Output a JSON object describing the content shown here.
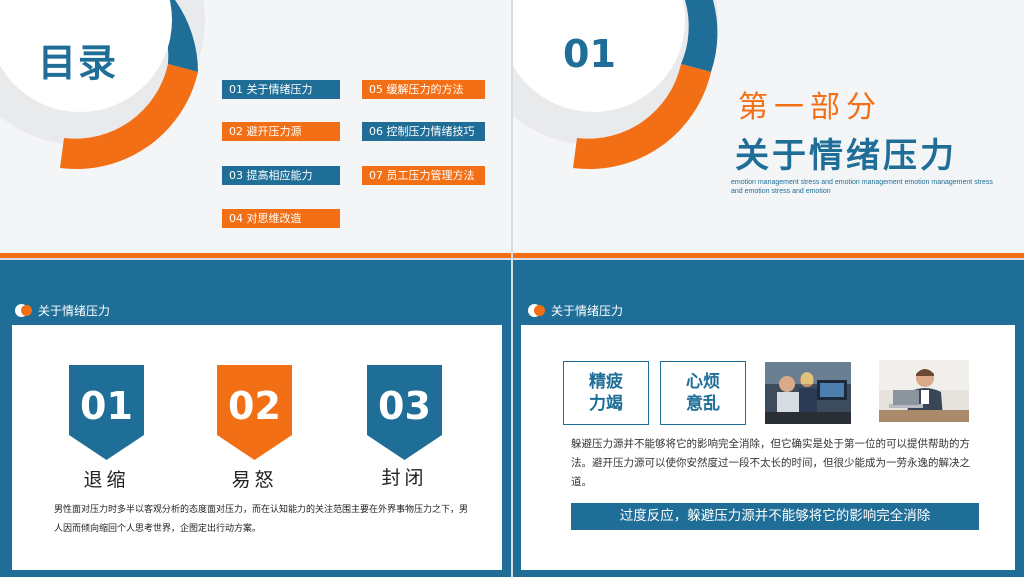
{
  "colors": {
    "blue": "#1f6e98",
    "orange": "#f36f16",
    "background": "#f4f5f7"
  },
  "slide1": {
    "title": "目录",
    "items": [
      {
        "label": "01 关于情绪压力",
        "color": "blue"
      },
      {
        "label": "02 避开压力源",
        "color": "orange"
      },
      {
        "label": "03 提高相应能力",
        "color": "blue"
      },
      {
        "label": "04 对思维改造",
        "color": "orange"
      },
      {
        "label": "05 缓解压力的方法",
        "color": "orange"
      },
      {
        "label": "06 控制压力情绪技巧",
        "color": "blue"
      },
      {
        "label": "07 员工压力管理方法",
        "color": "orange"
      }
    ]
  },
  "slide2": {
    "number": "01",
    "part_label": "第一部分",
    "part_title": "关于情绪压力",
    "english": "emotion management stress and emotion management emotion management stress and emotion stress and emotion"
  },
  "slide3": {
    "header": "关于情绪压力",
    "badges": [
      {
        "number": "01",
        "label": "退缩",
        "color": "blue"
      },
      {
        "number": "02",
        "label": "易怒",
        "color": "orange"
      },
      {
        "number": "03",
        "label": "封闭",
        "color": "blue"
      }
    ],
    "description": "男性面对压力时多半以客观分析的态度面对压力，而在认知能力的关注范围主要在外界事物压力之下，男人因而倾向缩回个人思考世界，企图定出行动方案。"
  },
  "slide4": {
    "header": "关于情绪压力",
    "boxes": [
      "精疲力竭",
      "心烦意乱"
    ],
    "photos": [
      "office-workers-photo",
      "businessman-laptop-photo"
    ],
    "description": "躲避压力源并不能够将它的影响完全消除，但它确实是处于第一位的可以提供帮助的方法。避开压力源可以使你安然度过一段不太长的时间，但很少能成为一劳永逸的解决之道。",
    "banner": "过度反应，躲避压力源并不能够将它的影响完全消除"
  }
}
